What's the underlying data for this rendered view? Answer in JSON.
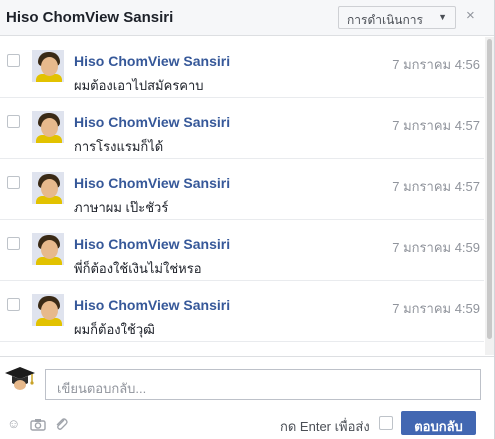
{
  "header": {
    "title": "Hiso ChomView Sansiri",
    "actions_label": "การดำเนินการ",
    "close_glyph": "×"
  },
  "messages": [
    {
      "sender": "Hiso ChomView Sansiri",
      "text": "ผมต้องเอาไปสมัครคาบ",
      "time": "7 มกราคม 4:56"
    },
    {
      "sender": "Hiso ChomView Sansiri",
      "text": "การโรงแรมก็ได้",
      "time": "7 มกราคม 4:57"
    },
    {
      "sender": "Hiso ChomView Sansiri",
      "text": "ภาษาผม เป๊ะชัวร์",
      "time": "7 มกราคม 4:57"
    },
    {
      "sender": "Hiso ChomView Sansiri",
      "text": "พี่ก็ต้องใช้เงินไม่ใช่หรอ",
      "time": "7 มกราคม 4:59"
    },
    {
      "sender": "Hiso ChomView Sansiri",
      "text": "ผมก็ต้องใช้วุฒิ",
      "time": "7 มกราคม 4:59"
    }
  ],
  "reply": {
    "placeholder": "เขียนตอบกลับ...",
    "enter_to_send_label": "กด Enter เพื่อส่ง",
    "button_label": "ตอบกลับ"
  },
  "icons": {
    "emoji": "smiley-icon",
    "camera": "camera-icon",
    "attach": "paperclip-icon",
    "user": "graduation-cap-icon"
  }
}
